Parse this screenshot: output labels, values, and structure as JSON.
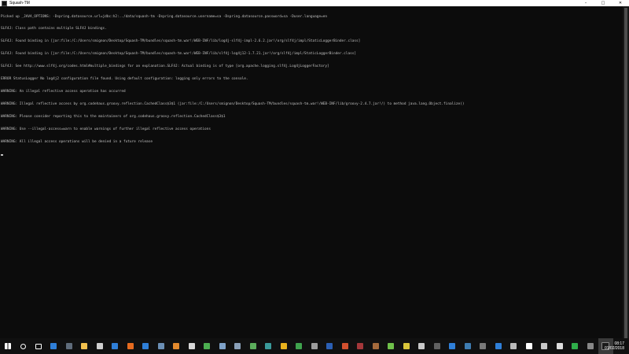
{
  "window": {
    "title": "Squash-TM",
    "controls": {
      "minimize": "–",
      "maximize": "□",
      "close": "✕"
    }
  },
  "console": {
    "lines": [
      "Picked up _JAVA_OPTIONS: -Dspring.datasource.url=jdbc:h2:../data/squash-tm -Dspring.datasource.username=sa -Dspring.datasource.password=sa -Duser.language=en",
      "SLF4J: Class path contains multiple SLF4J bindings.",
      "SLF4J: Found binding in [jar:file:/C:/Users/smignon/Desktop/Squash-TM/bundles/squash-tm.war!/WEB-INF/lib/log4j-slf4j-impl-2.6.2.jar!/org/slf4j/impl/StaticLoggerBinder.class]",
      "SLF4J: Found binding in [jar:file:/C:/Users/smignon/Desktop/Squash-TM/bundles/squash-tm.war!/WEB-INF/lib/slf4j-log4j12-1.7.21.jar!/org/slf4j/impl/StaticLoggerBinder.class]",
      "SLF4J: See http://www.slf4j.org/codes.html#multiple_bindings for an explanation.SLF4J: Actual binding is of type [org.apache.logging.slf4j.Log4jLoggerFactory]",
      "ERROR StatusLogger No log4j2 configuration file found. Using default configuration: logging only errors to the console.",
      "WARNING: An illegal reflective access operation has occurred",
      "WARNING: Illegal reflective access by org.codehaus.groovy.reflection.CachedClass$3$1 (jar:file:/C:/Users/smignon/Desktop/Squash-TM/bundles/squash-tm.war!/WEB-INF/lib/groovy-2.4.7.jar!/) to method java.lang.Object.finalize()",
      "WARNING: Please consider reporting this to the maintainers of org.codehaus.groovy.reflection.CachedClass$3$1",
      "WARNING: Use --illegal-access=warn to enable warnings of further illegal reflective access operations",
      "WARNING: All illegal access operations will be denied in a future release"
    ]
  },
  "taskbar": {
    "icons": [
      {
        "name": "start-windows-icon",
        "color": "#ffffff"
      },
      {
        "name": "search-icon",
        "color": "#ffffff"
      },
      {
        "name": "task-view-icon",
        "color": "#ffffff"
      },
      {
        "name": "mail-icon",
        "color": "#2f7fd8"
      },
      {
        "name": "calculator-icon",
        "color": "#5f6c7b"
      },
      {
        "name": "file-explorer-icon",
        "color": "#f2c14e"
      },
      {
        "name": "calculator-app-icon",
        "color": "#d0d0d0"
      },
      {
        "name": "edge-browser-icon",
        "color": "#2f7fd8"
      },
      {
        "name": "firefox-icon",
        "color": "#e66b1f"
      },
      {
        "name": "app-blue-icon",
        "color": "#2f7fd8"
      },
      {
        "name": "app-grid-icon",
        "color": "#6b8fb5"
      },
      {
        "name": "app-orange-icon",
        "color": "#e38a2e"
      },
      {
        "name": "app-light-icon",
        "color": "#d8d8d8"
      },
      {
        "name": "app-green-folder-icon",
        "color": "#4caf50"
      },
      {
        "name": "app-photo-icon",
        "color": "#7fa2c8"
      },
      {
        "name": "app-grid2-icon",
        "color": "#8aa0b8"
      },
      {
        "name": "app-green-icon",
        "color": "#5cae5c"
      },
      {
        "name": "app-teal-icon",
        "color": "#3a9a9a"
      },
      {
        "name": "chrome-icon",
        "color": "#e8b21d"
      },
      {
        "name": "app-check-icon",
        "color": "#3fa34d"
      },
      {
        "name": "app-device-icon",
        "color": "#9c9c9c"
      },
      {
        "name": "word-icon",
        "color": "#2b5fb4"
      },
      {
        "name": "powerpoint-icon",
        "color": "#d2502f"
      },
      {
        "name": "access-icon",
        "color": "#a4373a"
      },
      {
        "name": "app-brown-icon",
        "color": "#a56a3c"
      },
      {
        "name": "excel-icon",
        "color": "#6fc04a"
      },
      {
        "name": "app-yellow-icon",
        "color": "#d9c53a"
      },
      {
        "name": "app-image-icon",
        "color": "#c8c8c8"
      },
      {
        "name": "app-dark-icon",
        "color": "#606060"
      },
      {
        "name": "app-bolt-icon",
        "color": "#2f7fd8"
      },
      {
        "name": "app-globe-icon",
        "color": "#3e7cb1"
      },
      {
        "name": "app-storage-icon",
        "color": "#7a7a7a"
      },
      {
        "name": "app-cube-icon",
        "color": "#2f7fd8"
      },
      {
        "name": "app-pill-icon",
        "color": "#bbbbbb"
      },
      {
        "name": "app-envelope-icon",
        "color": "#ffffff"
      },
      {
        "name": "app-calendar-icon",
        "color": "#c8c8c8"
      },
      {
        "name": "app-doc-icon",
        "color": "#dddddd"
      },
      {
        "name": "app-chat-icon",
        "color": "#2fae4a"
      },
      {
        "name": "app-phone-icon",
        "color": "#888888"
      },
      {
        "name": "terminal-icon",
        "color": "#1a1a1a"
      }
    ],
    "active_index": 39
  },
  "tray": {
    "time": "08:17",
    "date": "01/02/2018"
  }
}
